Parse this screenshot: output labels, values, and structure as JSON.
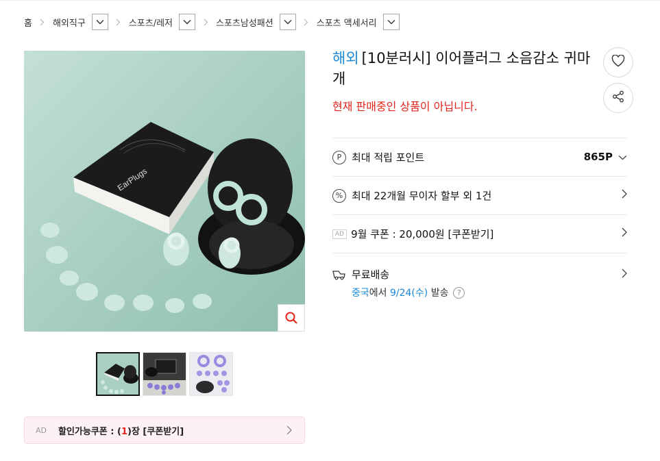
{
  "breadcrumb": {
    "home": "홈",
    "items": [
      "해외직구",
      "스포츠/레저",
      "스포츠남성패션",
      "스포츠 액세서리"
    ]
  },
  "product": {
    "overseas_label": "해외",
    "title": "[10분러시] 이어플러그 소음감소 귀마개",
    "status": "현재 판매중인 상품이 아닙니다.",
    "box_brand": "EarPlugs"
  },
  "points": {
    "icon": "P",
    "label": "최대 적립 포인트",
    "value": "865P"
  },
  "installment": {
    "icon": "%",
    "label": "최대 22개월 무이자 할부 외 1건"
  },
  "coupon_row": {
    "ad": "AD",
    "label": "9월 쿠폰 : 20,000원 [쿠폰받기]"
  },
  "shipping": {
    "label": "무료배송",
    "origin": "중국",
    "from_text": "에서",
    "date": "9/24(수)",
    "action": "발송",
    "help": "?"
  },
  "coupon_bar": {
    "ad": "AD",
    "prefix": "할인가능쿠폰 : (",
    "count": "1",
    "suffix": ")장 [쿠폰받기]"
  },
  "thumbnails_count": 3,
  "colors": {
    "accent_blue": "#1b88d6",
    "alert_red": "#e2231a",
    "image_bg": "#a9cfc2"
  },
  "icons": [
    "chevron-right-icon",
    "chevron-down-icon",
    "zoom-icon",
    "heart-icon",
    "share-icon",
    "truck-icon",
    "percent-icon",
    "point-icon"
  ]
}
